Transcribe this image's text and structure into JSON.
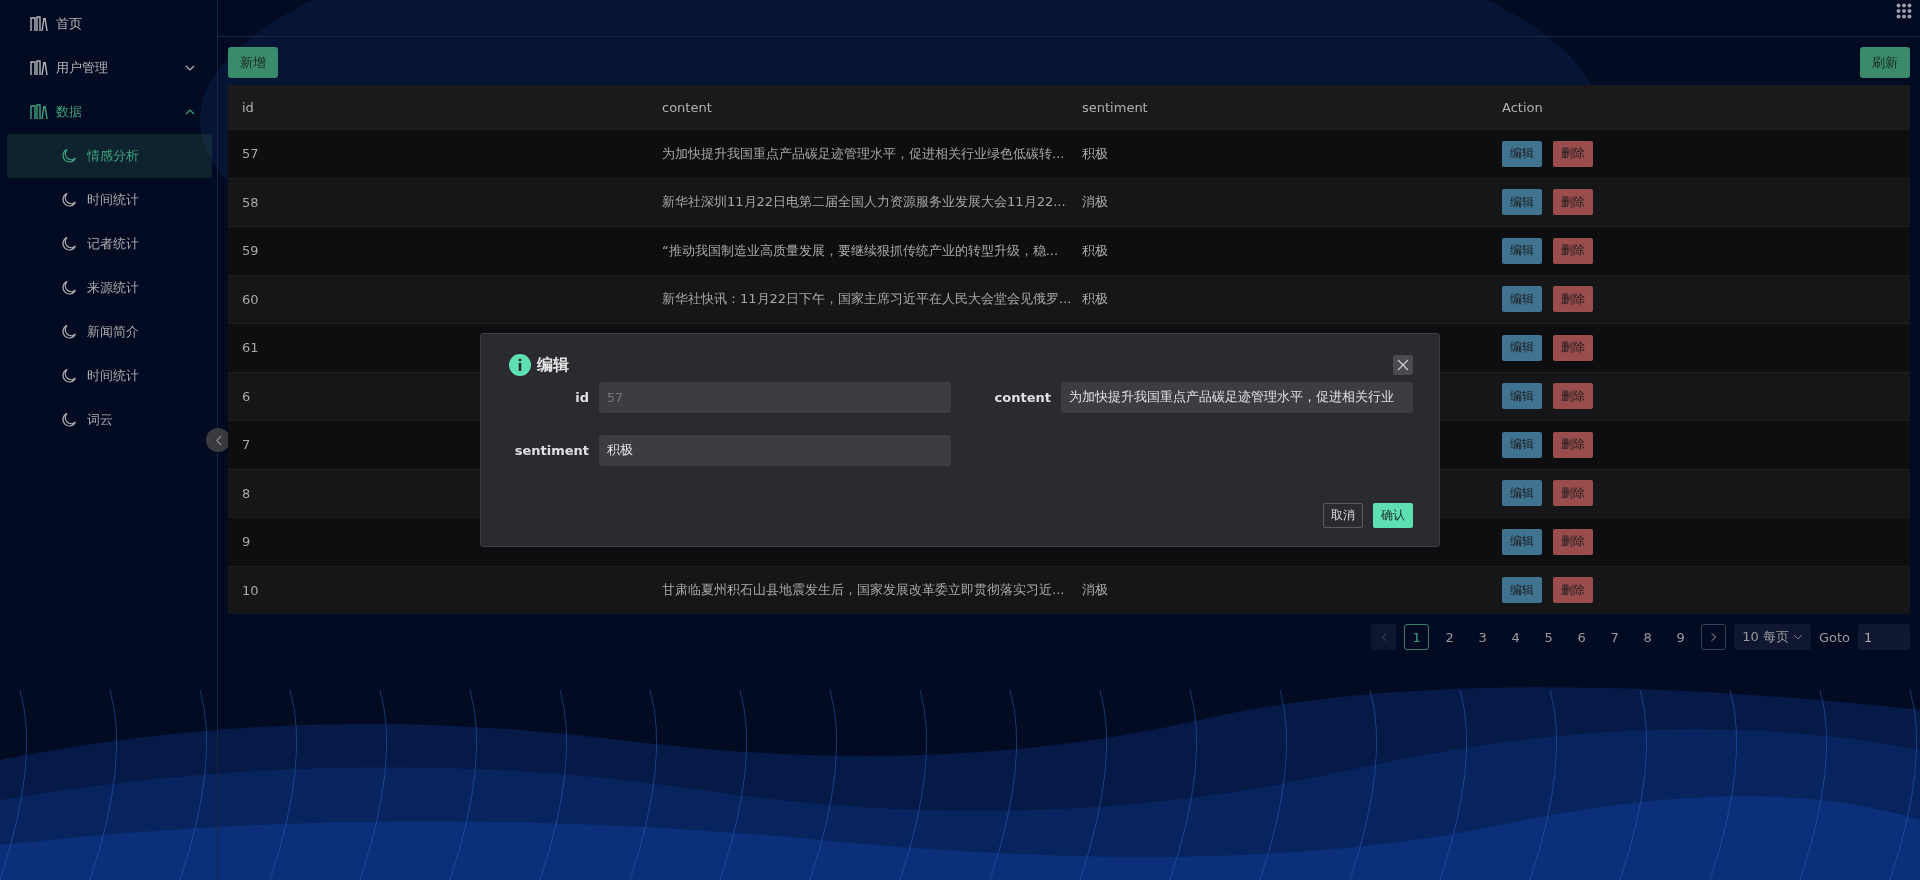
{
  "sidebar": {
    "items": [
      {
        "label": "首页",
        "kind": "link"
      },
      {
        "label": "用户管理",
        "kind": "group",
        "expanded": false
      },
      {
        "label": "数据",
        "kind": "group",
        "expanded": true,
        "children": [
          {
            "label": "情感分析",
            "selected": true
          },
          {
            "label": "时间统计",
            "selected": false
          },
          {
            "label": "记者统计",
            "selected": false
          },
          {
            "label": "来源统计",
            "selected": false
          },
          {
            "label": "新闻简介",
            "selected": false
          },
          {
            "label": "时间统计",
            "selected": false
          },
          {
            "label": "词云",
            "selected": false
          }
        ]
      }
    ]
  },
  "toolbar": {
    "add_button": "新增",
    "refresh_button": "刷新"
  },
  "table": {
    "columns": [
      "id",
      "content",
      "sentiment",
      "Action"
    ],
    "rows": [
      {
        "id": "57",
        "content": "为加快提升我国重点产品碳足迹管理水平，促进相关行业绿色低碳转...",
        "sentiment": "积极",
        "actions": [
          "编辑",
          "删除"
        ]
      },
      {
        "id": "58",
        "content": "新华社深圳11月22日电第二届全国人力资源服务业发展大会11月22...",
        "sentiment": "消极",
        "actions": [
          "编辑",
          "删除"
        ]
      },
      {
        "id": "59",
        "content": "“推动我国制造业高质量发展，要继续狠抓传统产业的转型升级，稳...",
        "sentiment": "积极",
        "actions": [
          "编辑",
          "删除"
        ]
      },
      {
        "id": "60",
        "content": "新华社快讯：11月22日下午，国家主席习近平在人民大会堂会见俄罗...",
        "sentiment": "积极",
        "actions": [
          "编辑",
          "删除"
        ]
      },
      {
        "id": "61",
        "actions": [
          "编辑",
          "删除"
        ]
      },
      {
        "id": "6",
        "actions": [
          "编辑",
          "删除"
        ]
      },
      {
        "id": "7",
        "actions": [
          "编辑",
          "删除"
        ]
      },
      {
        "id": "8",
        "actions": [
          "编辑",
          "删除"
        ]
      },
      {
        "id": "9",
        "actions": [
          "编辑",
          "删除"
        ]
      },
      {
        "id": "10",
        "content": "甘肃临夏州积石山县地震发生后，国家发展改革委立即贯彻落实习近...",
        "sentiment": "消极",
        "actions": [
          "编辑",
          "删除"
        ]
      }
    ]
  },
  "pagination": {
    "prev_disabled": true,
    "next_disabled": false,
    "pages": [
      {
        "label": "1",
        "selected": true
      },
      {
        "label": "2",
        "selected": false
      },
      {
        "label": "3",
        "selected": false
      },
      {
        "label": "4",
        "selected": false
      },
      {
        "label": "5",
        "selected": false
      },
      {
        "label": "6",
        "selected": false
      },
      {
        "label": "7",
        "selected": false
      },
      {
        "label": "8",
        "selected": false
      },
      {
        "label": "9",
        "selected": false
      }
    ],
    "page_size": "10 每页",
    "goto_label": "Goto",
    "goto_value": "1"
  },
  "modal": {
    "title": "编辑",
    "fields": [
      {
        "label": "id",
        "value": "57",
        "disabled": true
      },
      {
        "label": "content",
        "value": "为加快提升我国重点产品碳足迹管理水平，促进相关行业",
        "disabled": false
      },
      {
        "label": "sentiment",
        "value": "积极",
        "disabled": false
      }
    ],
    "cancel_button": "取消",
    "confirm_button": "确认"
  }
}
